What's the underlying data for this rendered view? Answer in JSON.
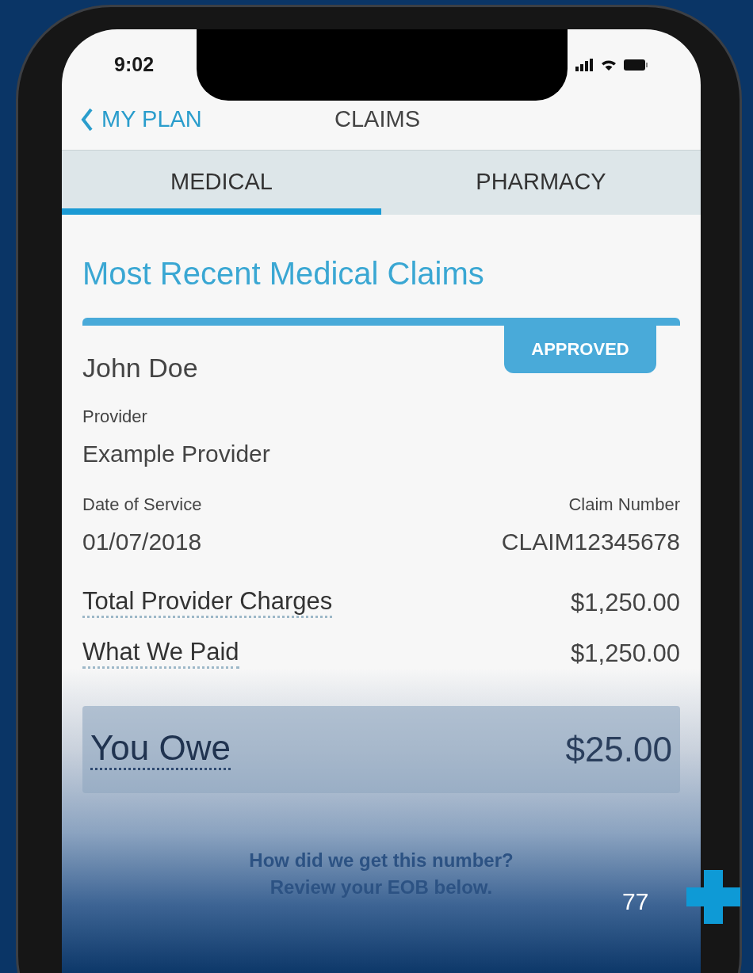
{
  "status_bar": {
    "time": "9:02"
  },
  "nav": {
    "back": "MY PLAN",
    "title": "CLAIMS"
  },
  "tabs": [
    {
      "label": "MEDICAL",
      "selected": true
    },
    {
      "label": "PHARMACY",
      "selected": false
    }
  ],
  "section_title": "Most Recent Medical Claims",
  "claim": {
    "member": "John Doe",
    "status": "APPROVED",
    "provider_label": "Provider",
    "provider": "Example Provider",
    "date_label": "Date of Service",
    "date": "01/07/2018",
    "claim_number_label": "Claim Number",
    "claim_number": "CLAIM12345678",
    "amounts": [
      {
        "label": "Total Provider Charges",
        "value": "$1,250.00"
      },
      {
        "label": "What We Paid",
        "value": "$1,250.00"
      }
    ],
    "total": {
      "label": "You Owe",
      "value": "$25.00"
    },
    "note": [
      "How did we get this number?",
      "Review your EOB below."
    ]
  },
  "page_number": "77"
}
